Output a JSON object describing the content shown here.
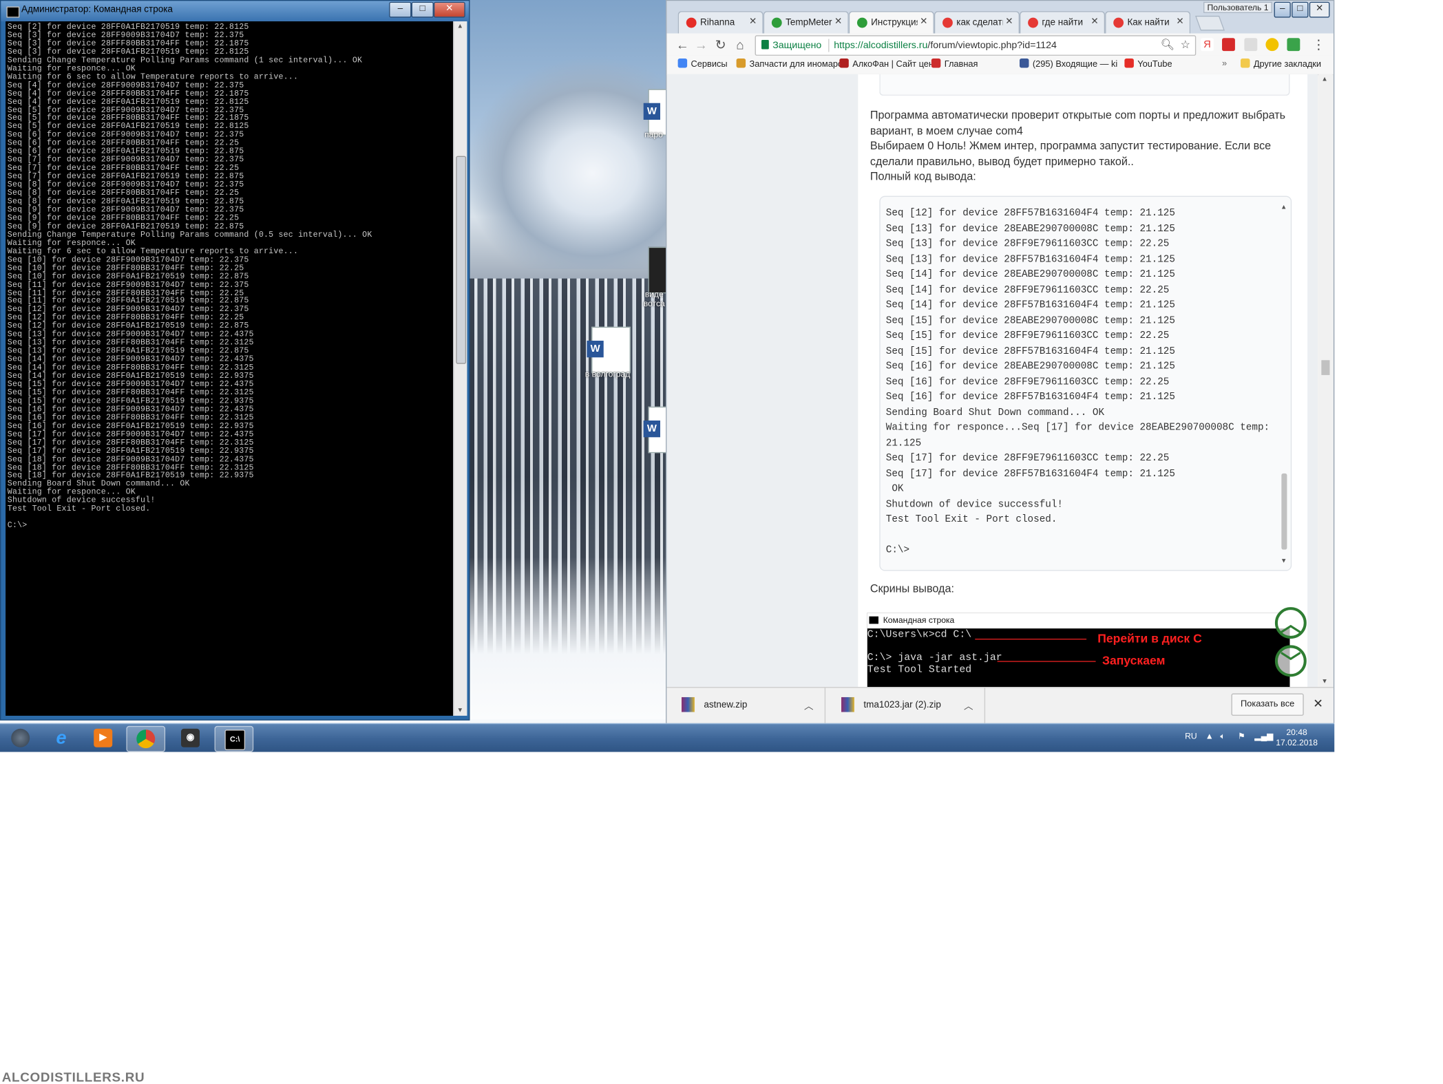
{
  "cmd": {
    "title": "Администратор: Командная строка",
    "lines": [
      "Seq [2] for device 28FF0A1FB2170519 temp: 22.8125",
      "Seq [3] for device 28FF9009B31704D7 temp: 22.375",
      "Seq [3] for device 28FFF80BB31704FF temp: 22.1875",
      "Seq [3] for device 28FF0A1FB2170519 temp: 22.8125",
      "Sending Change Temperature Polling Params command (1 sec interval)... OK",
      "Waiting for responce... OK",
      "Waiting for 6 sec to allow Temperature reports to arrive...",
      "Seq [4] for device 28FF9009B31704D7 temp: 22.375",
      "Seq [4] for device 28FFF80BB31704FF temp: 22.1875",
      "Seq [4] for device 28FF0A1FB2170519 temp: 22.8125",
      "Seq [5] for device 28FF9009B31704D7 temp: 22.375",
      "Seq [5] for device 28FFF80BB31704FF temp: 22.1875",
      "Seq [5] for device 28FF0A1FB2170519 temp: 22.8125",
      "Seq [6] for device 28FF9009B31704D7 temp: 22.375",
      "Seq [6] for device 28FFF80BB31704FF temp: 22.25",
      "Seq [6] for device 28FF0A1FB2170519 temp: 22.875",
      "Seq [7] for device 28FF9009B31704D7 temp: 22.375",
      "Seq [7] for device 28FFF80BB31704FF temp: 22.25",
      "Seq [7] for device 28FF0A1FB2170519 temp: 22.875",
      "Seq [8] for device 28FF9009B31704D7 temp: 22.375",
      "Seq [8] for device 28FFF80BB31704FF temp: 22.25",
      "Seq [8] for device 28FF0A1FB2170519 temp: 22.875",
      "Seq [9] for device 28FF9009B31704D7 temp: 22.375",
      "Seq [9] for device 28FFF80BB31704FF temp: 22.25",
      "Seq [9] for device 28FF0A1FB2170519 temp: 22.875",
      "Sending Change Temperature Polling Params command (0.5 sec interval)... OK",
      "Waiting for responce... OK",
      "Waiting for 6 sec to allow Temperature reports to arrive...",
      "Seq [10] for device 28FF9009B31704D7 temp: 22.375",
      "Seq [10] for device 28FFF80BB31704FF temp: 22.25",
      "Seq [10] for device 28FF0A1FB2170519 temp: 22.875",
      "Seq [11] for device 28FF9009B31704D7 temp: 22.375",
      "Seq [11] for device 28FFF80BB31704FF temp: 22.25",
      "Seq [11] for device 28FF0A1FB2170519 temp: 22.875",
      "Seq [12] for device 28FF9009B31704D7 temp: 22.375",
      "Seq [12] for device 28FFF80BB31704FF temp: 22.25",
      "Seq [12] for device 28FF0A1FB2170519 temp: 22.875",
      "Seq [13] for device 28FF9009B31704D7 temp: 22.4375",
      "Seq [13] for device 28FFF80BB31704FF temp: 22.3125",
      "Seq [13] for device 28FF0A1FB2170519 temp: 22.875",
      "Seq [14] for device 28FF9009B31704D7 temp: 22.4375",
      "Seq [14] for device 28FFF80BB31704FF temp: 22.3125",
      "Seq [14] for device 28FF0A1FB2170519 temp: 22.9375",
      "Seq [15] for device 28FF9009B31704D7 temp: 22.4375",
      "Seq [15] for device 28FFF80BB31704FF temp: 22.3125",
      "Seq [15] for device 28FF0A1FB2170519 temp: 22.9375",
      "Seq [16] for device 28FF9009B31704D7 temp: 22.4375",
      "Seq [16] for device 28FFF80BB31704FF temp: 22.3125",
      "Seq [16] for device 28FF0A1FB2170519 temp: 22.9375",
      "Seq [17] for device 28FF9009B31704D7 temp: 22.4375",
      "Seq [17] for device 28FFF80BB31704FF temp: 22.3125",
      "Seq [17] for device 28FF0A1FB2170519 temp: 22.9375",
      "Seq [18] for device 28FF9009B31704D7 temp: 22.4375",
      "Seq [18] for device 28FFF80BB31704FF temp: 22.3125",
      "Seq [18] for device 28FF0A1FB2170519 temp: 22.9375",
      "Sending Board Shut Down command... OK",
      "Waiting for responce... OK",
      "Shutdown of device successful!",
      "Test Tool Exit - Port closed.",
      "",
      "C:\\>"
    ]
  },
  "desktop": {
    "icons": [
      {
        "label": "паро"
      },
      {
        "label": "виде\nвотса"
      },
      {
        "label": "в волгоград"
      },
      {
        "label": ""
      }
    ]
  },
  "browser": {
    "tabs": [
      {
        "label": "Rihanna",
        "color": "#e52d27"
      },
      {
        "label": "TempMeter",
        "color": "#2e9d3a"
      },
      {
        "label": "Инструкция",
        "color": "#2e9d3a"
      },
      {
        "label": "как сделать",
        "color": "#e53935"
      },
      {
        "label": "где найти",
        "color": "#e53935"
      },
      {
        "label": "Как найти",
        "color": "#e53935"
      }
    ],
    "user_badge": "Пользователь 1",
    "secure_label": "Защищено",
    "url_host": "https://alcodistillers.ru",
    "url_path": "/forum/viewtopic.php?id=1124",
    "bookmarks": [
      {
        "label": "Сервисы",
        "color": "#4285f4"
      },
      {
        "label": "Запчасти для иномарок",
        "color": "#d89b2b"
      },
      {
        "label": "АлкоФан | Сайт цени",
        "color": "#b02020"
      },
      {
        "label": "Главная",
        "color": "#cc2b2b"
      },
      {
        "label": "(295) Входящие — ki",
        "color": "#3b5998"
      },
      {
        "label": "YouTube",
        "color": "#e52d27"
      }
    ],
    "other_bookmarks": "Другие закладки",
    "post": {
      "para1": "Программа автоматически проверит открытые com порты и предложит выбрать вариант, в моем случае com4",
      "para2": "Выбираем 0 Ноль! Жмем интер, программа запустит тестирование.  Если все сделали правильно, вывод будет примерно такой..",
      "para3": "Полный код вывода:",
      "code": "Seq [12] for device 28FF57B1631604F4 temp: 21.125\nSeq [13] for device 28EABE290700008C temp: 21.125\nSeq [13] for device 28FF9E79611603CC temp: 22.25\nSeq [13] for device 28FF57B1631604F4 temp: 21.125\nSeq [14] for device 28EABE290700008C temp: 21.125\nSeq [14] for device 28FF9E79611603CC temp: 22.25\nSeq [14] for device 28FF57B1631604F4 temp: 21.125\nSeq [15] for device 28EABE290700008C temp: 21.125\nSeq [15] for device 28FF9E79611603CC temp: 22.25\nSeq [15] for device 28FF57B1631604F4 temp: 21.125\nSeq [16] for device 28EABE290700008C temp: 21.125\nSeq [16] for device 28FF9E79611603CC temp: 22.25\nSeq [16] for device 28FF57B1631604F4 temp: 21.125\nSending Board Shut Down command... OK\nWaiting for responce...Seq [17] for device 28EABE290700008C temp: 21.125\nSeq [17] for device 28FF9E79611603CC temp: 22.25\nSeq [17] for device 28FF57B1631604F4 temp: 21.125\n OK\nShutdown of device successful!\nTest Tool Exit - Port closed.\n\nC:\\>",
      "screens_label": "Скрины вывода:",
      "shot_title": "Командная строка",
      "shot_line1": "C:\\Users\\к>cd C:\\",
      "shot_line2": "C:\\> java -jar ast.jar",
      "shot_line3": "Test Tool Started",
      "shot_ann1": "Перейти в диск С",
      "shot_ann2": "Запускаем"
    },
    "downloads": [
      {
        "name": "astnew.zip"
      },
      {
        "name": "tma1023.jar (2).zip"
      }
    ],
    "show_all": "Показать все"
  },
  "taskbar": {
    "lang": "RU",
    "time": "20:48",
    "date": "17.02.2018"
  },
  "watermark": "ALCODISTILLERS.RU"
}
